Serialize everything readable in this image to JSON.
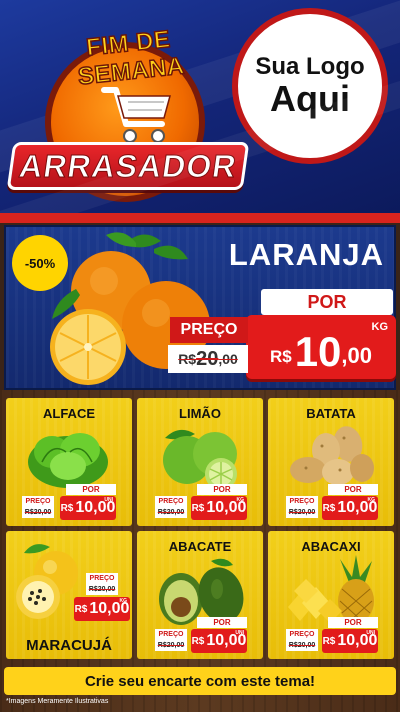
{
  "header": {
    "badge_top": "FIM DE SEMANA",
    "badge_bottom": "ARRASADOR",
    "logo_line1": "Sua Logo",
    "logo_line2": "Aqui"
  },
  "hero": {
    "discount": "-50%",
    "title": "LARANJA",
    "por": "POR",
    "preco": "PREÇO",
    "old_currency": "R$",
    "old_int": "20",
    "old_dec": ",00",
    "currency": "R$",
    "price_int": "10",
    "price_dec": ",00",
    "unit": "KG"
  },
  "products": [
    {
      "name": "ALFACE",
      "preco": "PREÇO",
      "old": "R$20,00",
      "por": "POR",
      "unit": "UNI",
      "currency": "R$",
      "price": "10,00"
    },
    {
      "name": "LIMÃO",
      "preco": "PREÇO",
      "old": "R$20,00",
      "por": "POR",
      "unit": "KG",
      "currency": "R$",
      "price": "10,00"
    },
    {
      "name": "BATATA",
      "preco": "PREÇO",
      "old": "R$20,00",
      "por": "POR",
      "unit": "KG",
      "currency": "R$",
      "price": "10,00"
    },
    {
      "name": "MARACUJÁ",
      "preco": "PREÇO",
      "old": "R$20,00",
      "por": "POR",
      "unit": "KG",
      "currency": "R$",
      "price": "10,00"
    },
    {
      "name": "ABACATE",
      "preco": "PREÇO",
      "old": "R$20,00",
      "por": "POR",
      "unit": "UNI",
      "currency": "R$",
      "price": "10,00"
    },
    {
      "name": "ABACAXI",
      "preco": "PREÇO",
      "old": "R$20,00",
      "por": "POR",
      "unit": "UNI",
      "currency": "R$",
      "price": "10,00"
    }
  ],
  "footer": {
    "cta": "Crie seu encarte com este tema!",
    "disclaimer": "*Imagens Meramente Ilustrativas"
  },
  "colors": {
    "header_blue": "#14267a",
    "accent_red": "#e21b1b",
    "card_yellow": "#f2cf1a",
    "badge_yellow": "#ffd400"
  }
}
